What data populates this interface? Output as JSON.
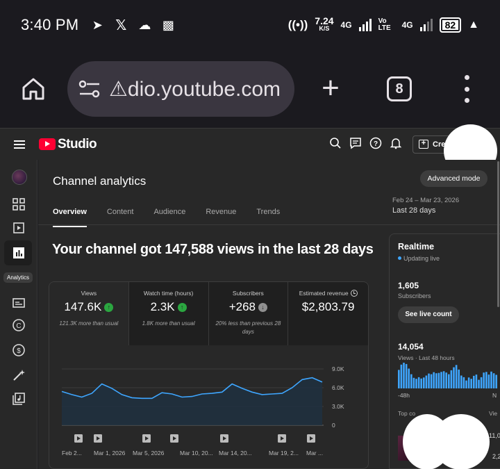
{
  "status": {
    "time": "3:40 PM",
    "net_speed": "7.24",
    "net_unit": "K/S",
    "network1": "4G",
    "volte": "Vo LTE",
    "network2": "4G",
    "battery": "82"
  },
  "browser": {
    "url": "⚠dio.youtube.com",
    "tab_count": "8"
  },
  "studio": {
    "brand": "Studio",
    "create_label": "Cre",
    "page_title": "Channel analytics",
    "advanced_mode": "Advanced mode",
    "tabs": [
      "Overview",
      "Content",
      "Audience",
      "Revenue",
      "Trends"
    ],
    "date_range": "Feb 24 – Mar 23, 2026",
    "date_label": "Last 28 days",
    "rail_active_label": "Analytics",
    "headline": "Your channel got 147,588 views in the last 28 days"
  },
  "metrics": [
    {
      "label": "Views",
      "value": "147.6K",
      "trend": "up",
      "note": "121.3K more than usual"
    },
    {
      "label": "Watch time (hours)",
      "value": "2.3K",
      "trend": "up",
      "note": "1.8K more than usual"
    },
    {
      "label": "Subscribers",
      "value": "+268",
      "trend": "down",
      "note": "20% less than previous 28 days"
    },
    {
      "label": "Estimated revenue",
      "value": "$2,803.79",
      "trend": "none",
      "note": ""
    }
  ],
  "colors": {
    "accent_up": "#2ba640",
    "accent_down": "#909090",
    "brand_red": "#ff0033",
    "live_dot": "#3ea6ff",
    "chart_line": "#3ea6ff"
  },
  "chart_data": {
    "type": "area",
    "y_ticks": [
      "9.0K",
      "6.0K",
      "3.0K",
      "0"
    ],
    "ylim": [
      0,
      9000
    ],
    "x_ticks": [
      "Feb 2...",
      "Mar 1, 2026",
      "Mar 5, 2026",
      "Mar 10, 20...",
      "Mar 14, 20...",
      "Mar 19, 2...",
      "Mar ..."
    ],
    "series": [
      {
        "values": [
          5400,
          4900,
          4500,
          5100,
          6600,
          5900,
          4900,
          4400,
          4300,
          4300,
          5200,
          5000,
          4500,
          4600,
          5000,
          5100,
          5300,
          6600,
          5900,
          5300,
          4900,
          5000,
          5100,
          6000,
          7300,
          7600,
          6900
        ]
      }
    ],
    "grid": true
  },
  "realtime": {
    "title": "Realtime",
    "status": "Updating live",
    "subscribers": "1,605",
    "subscribers_label": "Subscribers",
    "see_live": "See live count",
    "views": "14,054",
    "views_label": "Views · Last 48 hours",
    "axis_left": "-48h",
    "axis_right": "N",
    "top_content": "Top co",
    "views_col": "Vie",
    "row1_views": "11,0",
    "row2_views": "2,2",
    "bars": [
      5.6,
      7.2,
      7.8,
      7.4,
      6.0,
      4.3,
      3.2,
      2.9,
      3.4,
      3.0,
      3.3,
      3.9,
      4.5,
      4.3,
      4.9,
      4.6,
      4.7,
      5.0,
      5.2,
      4.8,
      4.3,
      5.5,
      6.4,
      7.1,
      5.7,
      3.9,
      3.4,
      2.4,
      3.3,
      2.9,
      3.8,
      4.2,
      2.6,
      3.4,
      4.8,
      5.0,
      4.2,
      5.1,
      4.6,
      4.1
    ]
  }
}
